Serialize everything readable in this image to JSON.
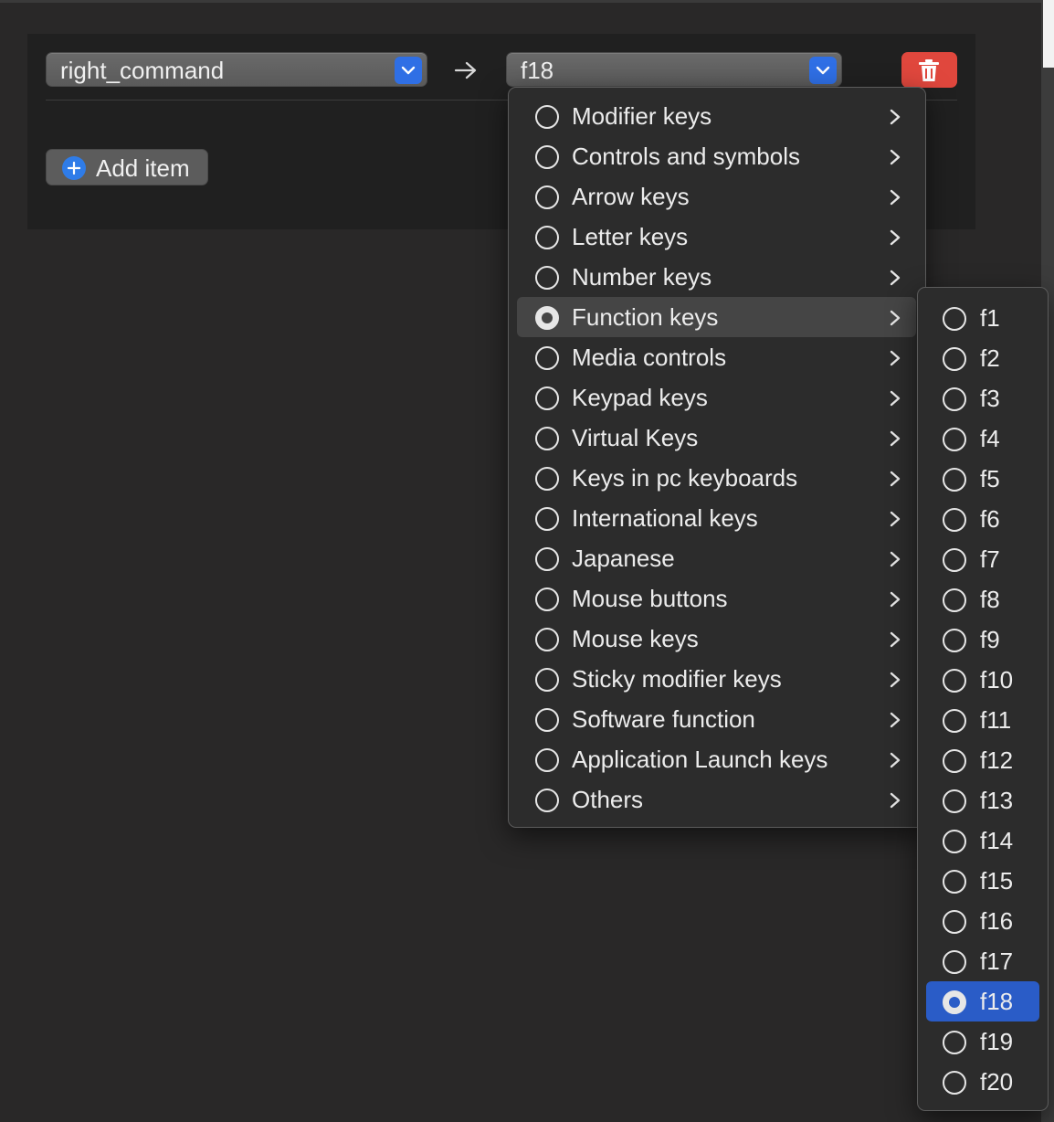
{
  "rule": {
    "from_key": "right_command",
    "to_key": "f18",
    "add_item_label": "Add item"
  },
  "menu": {
    "categories": [
      "Modifier keys",
      "Controls and symbols",
      "Arrow keys",
      "Letter keys",
      "Number keys",
      "Function keys",
      "Media controls",
      "Keypad keys",
      "Virtual Keys",
      "Keys in pc keyboards",
      "International keys",
      "Japanese",
      "Mouse buttons",
      "Mouse keys",
      "Sticky modifier keys",
      "Software function",
      "Application Launch keys",
      "Others"
    ],
    "selected_category": "Function keys",
    "function_keys": [
      "f1",
      "f2",
      "f3",
      "f4",
      "f5",
      "f6",
      "f7",
      "f8",
      "f9",
      "f10",
      "f11",
      "f12",
      "f13",
      "f14",
      "f15",
      "f16",
      "f17",
      "f18",
      "f19",
      "f20"
    ],
    "selected_key": "f18"
  },
  "colors": {
    "accent": "#2f6fe5",
    "delete": "#e0473d",
    "selection": "#2a5cc7"
  },
  "icons": {
    "dropdown": "chevron-down-icon",
    "arrow": "arrow-right-icon",
    "delete": "trash-icon",
    "add": "plus-circle-icon",
    "submenu": "chevron-right-icon"
  }
}
